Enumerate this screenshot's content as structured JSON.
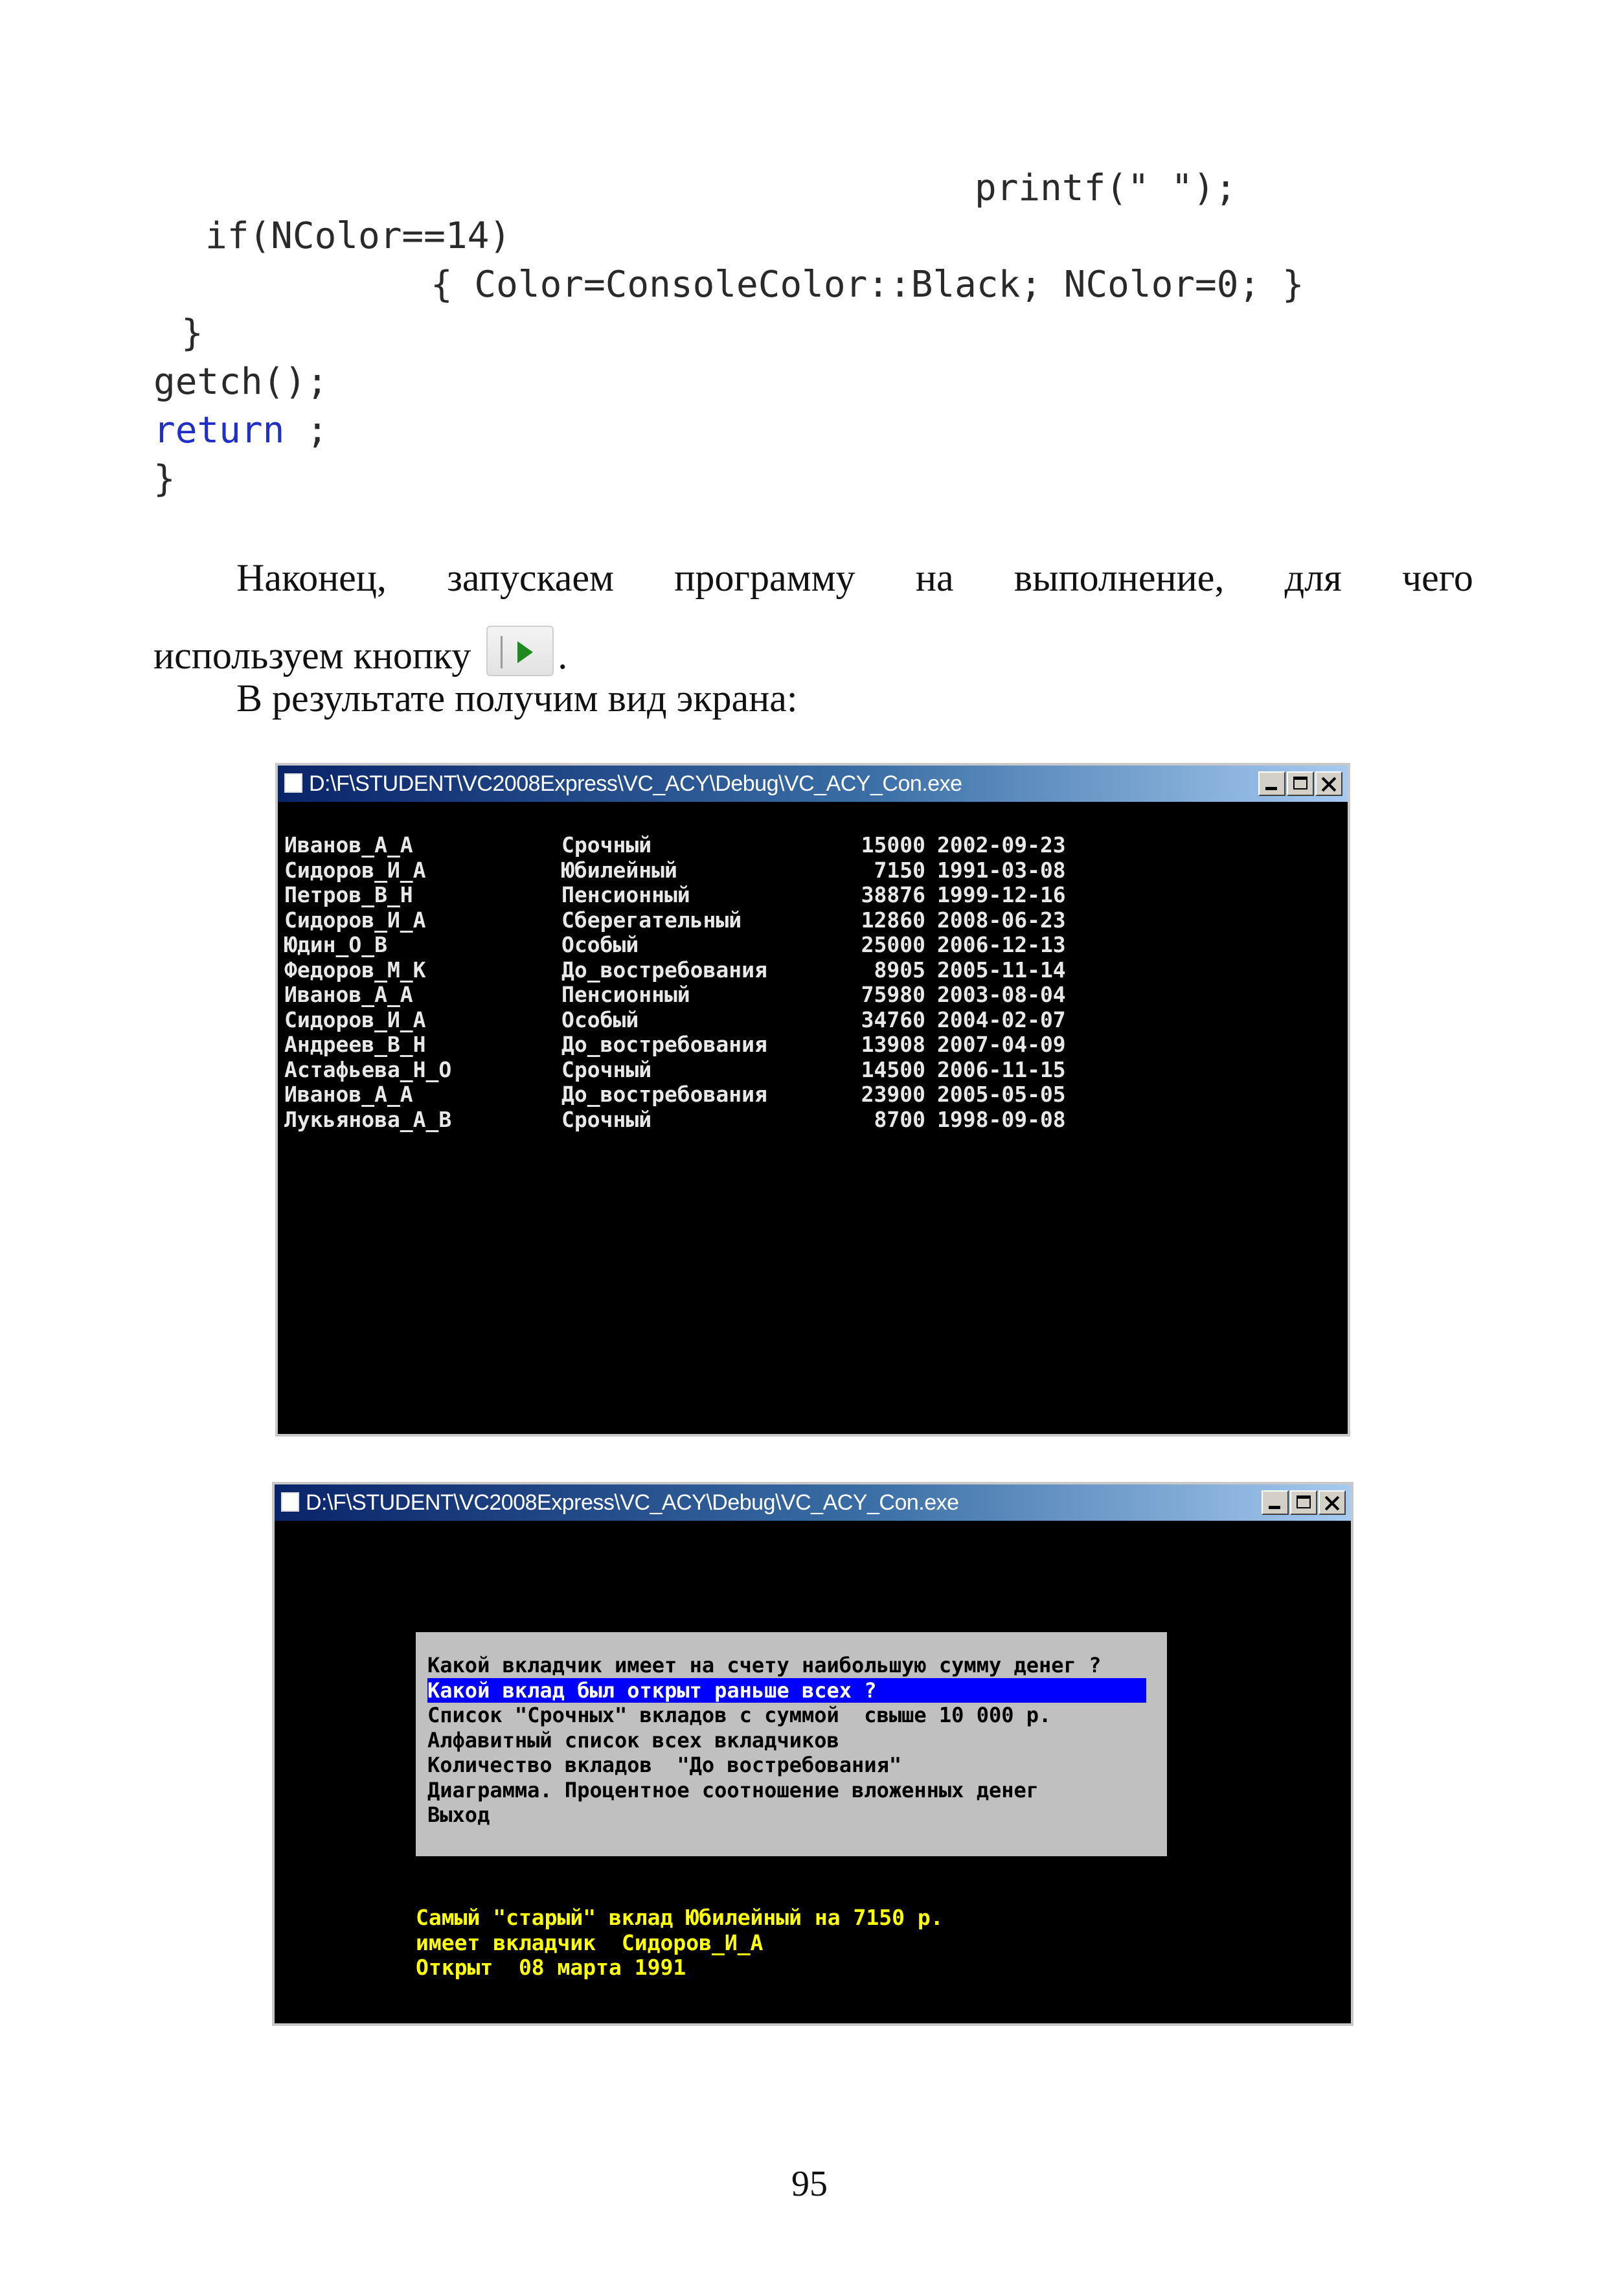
{
  "code": {
    "line1": "printf(\" \");",
    "line2": "if(NColor==14)",
    "line3": "{ Color=ConsoleColor::Black; NColor=0; }",
    "line4": "}",
    "line5": "getch();",
    "line6_kw": "return",
    "line6_rest": " ;",
    "line7": "}"
  },
  "paragraph": {
    "line1_words": [
      "Наконец,",
      "запускаем",
      "программу",
      "на",
      "выполнение,",
      "для",
      "чего"
    ],
    "line2_before": "используем кнопку",
    "line2_after": ".",
    "line3": "В результате получим вид экрана:",
    "button_icon": "run-play-icon"
  },
  "window1": {
    "title": "D:\\F\\STUDENT\\VC2008Express\\VC_ACY\\Debug\\VC_ACY_Con.exe",
    "rows": [
      {
        "name": "Иванов_А_А",
        "type": "Срочный",
        "sum": "15000",
        "date": "2002-09-23"
      },
      {
        "name": "Сидоров_И_А",
        "type": "Юбилейный",
        "sum": "7150",
        "date": "1991-03-08"
      },
      {
        "name": "Петров_В_Н",
        "type": "Пенсионный",
        "sum": "38876",
        "date": "1999-12-16"
      },
      {
        "name": "Сидоров_И_А",
        "type": "Сберегательный",
        "sum": "12860",
        "date": "2008-06-23"
      },
      {
        "name": "Юдин_О_В",
        "type": "Особый",
        "sum": "25000",
        "date": "2006-12-13"
      },
      {
        "name": "Федоров_М_К",
        "type": "До_востребования",
        "sum": "8905",
        "date": "2005-11-14"
      },
      {
        "name": "Иванов_А_А",
        "type": "Пенсионный",
        "sum": "75980",
        "date": "2003-08-04"
      },
      {
        "name": "Сидоров_И_А",
        "type": "Особый",
        "sum": "34760",
        "date": "2004-02-07"
      },
      {
        "name": "Андреев_В_Н",
        "type": "До_востребования",
        "sum": "13908",
        "date": "2007-04-09"
      },
      {
        "name": "Астафьева_Н_О",
        "type": "Срочный",
        "sum": "14500",
        "date": "2006-11-15"
      },
      {
        "name": "Иванов_А_А",
        "type": "До_востребования",
        "sum": "23900",
        "date": "2005-05-05"
      },
      {
        "name": "Лукьянова_А_В",
        "type": "Срочный",
        "sum": "8700",
        "date": "1998-09-08"
      }
    ]
  },
  "window2": {
    "title": "D:\\F\\STUDENT\\VC2008Express\\VC_ACY\\Debug\\VC_ACY_Con.exe",
    "menu": [
      "Какой вкладчик имеет на счету наибольшую сумму денег ?",
      "Какой вклад был открыт раньше всех ?",
      "Список \"Срочных\" вкладов с суммой  свыше 10 000 р.",
      "Алфавитный список всех вкладчиков",
      "Количество вкладов  \"До востребования\"",
      "Диаграмма. Процентное соотношение вложенных денег",
      "Выход"
    ],
    "selected_index": 1,
    "result": [
      "Самый \"старый\" вклад Юбилейный на 7150 р.",
      "имеет вкладчик  Сидоров_И_А",
      "Открыт  08 марта 1991"
    ]
  },
  "page_number": "95"
}
